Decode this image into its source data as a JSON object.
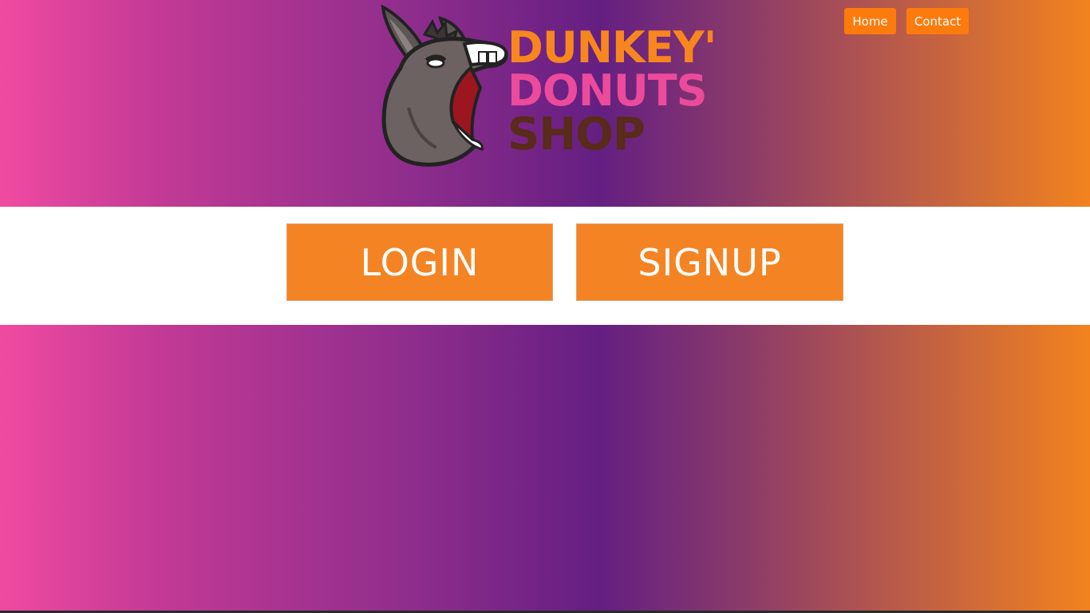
{
  "nav": {
    "home_label": "Home",
    "contact_label": "Contact",
    "button_color": "#fd7b0d"
  },
  "logo": {
    "line1": "DUNKEY'",
    "line2": "DONUTS",
    "line3": "SHOP",
    "line1_color": "#f8861f",
    "line2_color": "#ec4a9b",
    "line3_color": "#5a2a1a",
    "mascot_icon": "donkey-icon"
  },
  "actions": {
    "login_label": "LOGIN",
    "signup_label": "SIGNUP",
    "button_color": "#f48423"
  },
  "theme": {
    "gradient_left": "#f04aa0",
    "gradient_mid": "#641f82",
    "gradient_right": "#f2821e"
  }
}
